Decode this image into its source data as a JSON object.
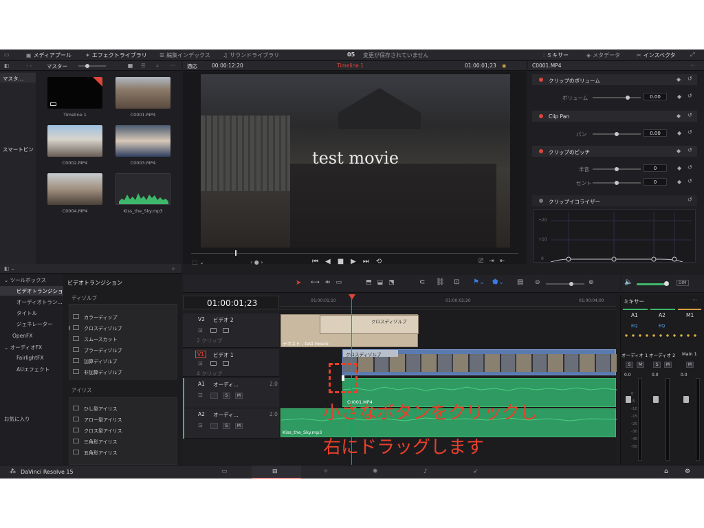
{
  "topbar": {
    "media_pool": "メディアプール",
    "effects_library": "エフェクトライブラリ",
    "edit_index": "編集インデックス",
    "sound_library": "サウンドライブラリ",
    "project_num": "05",
    "save_status": "変更が保存されていません",
    "mixer": "ミキサー",
    "metadata": "メタデータ",
    "inspector": "インスペクタ"
  },
  "mediapool": {
    "bin_label": "マスター",
    "sidebar_items": [
      "マスタ...",
      "スマートビン"
    ],
    "clips": [
      "Timeline 1",
      "C0001.MP4",
      "C0002.MP4",
      "C0003.MP4",
      "C0004.MP4",
      "Kiss_the_Sky.mp3"
    ]
  },
  "viewer": {
    "fit": "適応",
    "source_tc": "00:00:12:20",
    "timeline_name": "Timeline 1",
    "record_tc": "01:00:01;23",
    "overlay_text": "test movie"
  },
  "inspector": {
    "clip_name": "C0001.MP4",
    "sections": {
      "volume": {
        "title": "クリップのボリューム",
        "param": "ボリューム",
        "value": "0.00"
      },
      "pan": {
        "title": "Clip Pan",
        "param": "パン",
        "value": "0.00"
      },
      "pitch": {
        "title": "クリップのピッチ",
        "semitone": "半音",
        "semitone_val": "0",
        "cents": "セント",
        "cents_val": "0"
      },
      "eq": {
        "title": "クリップイコライザー",
        "db_labels": [
          "+20",
          "+10",
          "0"
        ]
      }
    }
  },
  "effects": {
    "tree": [
      "ツールボックス",
      "ビデオトランジション",
      "オーディオトラン...",
      "タイトル",
      "ジェネレーター",
      "OpenFX",
      "オーディオFX",
      "FairlightFX",
      "AUエフェクト",
      "お気に入り"
    ],
    "panel_title": "ビデオトランジション",
    "group1": "ディゾルブ",
    "dissolves": [
      "カラーディップ",
      "クロスディゾルブ",
      "スムースカット",
      "ブラーディゾルブ",
      "加算ディゾルブ",
      "非加算ディゾルブ"
    ],
    "group2": "アイリス",
    "iris": [
      "ひし型アイリス",
      "アロー型アイリス",
      "クロス型アイリス",
      "三角形アイリス",
      "五角形アイリス"
    ]
  },
  "timeline": {
    "timecode": "01:00:01;23",
    "ruler": [
      "01:00:01;10",
      "01:00:02;20",
      "01:00:04;00"
    ],
    "tracks": [
      {
        "id": "V2",
        "name": "ビデオ 2",
        "clips": "2 クリップ"
      },
      {
        "id": "V1",
        "name": "ビデオ 1",
        "clips": "4 クリップ"
      },
      {
        "id": "A1",
        "name": "オーディ...",
        "level": "2.0"
      },
      {
        "id": "A2",
        "name": "オーディ...",
        "level": "2.0"
      }
    ],
    "clip_text": "テキスト - test movie",
    "transition_label": "クロスディゾルブ",
    "transition_label2": "クロスディゾルブ",
    "audio_clip1": "C0001.MP4",
    "audio_clip2": "Kiss_the_Sky.mp3"
  },
  "mixer": {
    "title": "ミキサー",
    "channels": [
      "A1",
      "A2",
      "M1"
    ],
    "eq": "EQ",
    "names": [
      "オーディオ 1",
      "オーディオ 2",
      "Main 1"
    ],
    "level": "0.0",
    "scale": [
      "0",
      "-5",
      "-10",
      "-15",
      "-20",
      "-30",
      "-40",
      "-50"
    ]
  },
  "annotation": {
    "line1": "小さなボタンをクリックし",
    "line2": "右にドラッグします",
    "color": "#e8402a"
  },
  "footer": {
    "app_name": "DaVinci Resolve 15"
  }
}
